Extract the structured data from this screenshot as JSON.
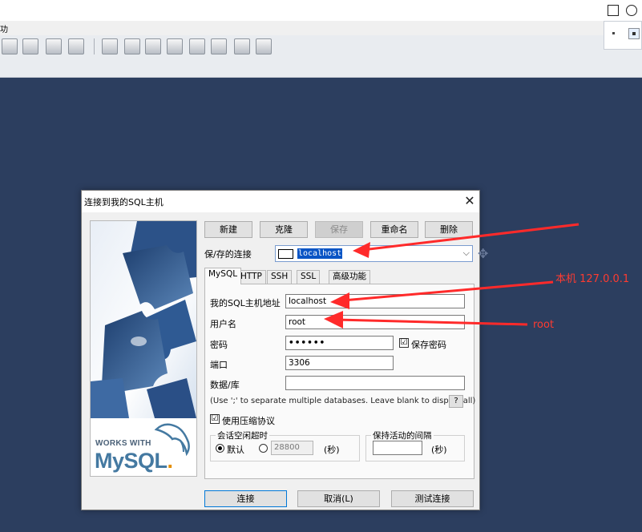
{
  "app": {
    "menu_fragment": "功",
    "toolbar_icons": [
      "new-query-icon",
      "open-icon",
      "save-icon",
      "export-icon",
      "backup-icon",
      "database-icon",
      "schema-icon",
      "scheduler-icon",
      "user-manager-icon",
      "history-icon",
      "grid-icon",
      "table-icon",
      "relations-icon"
    ]
  },
  "dialog": {
    "title": "连接到我的SQL主机",
    "buttons": {
      "new": "新建",
      "clone": "克隆",
      "save": "保存",
      "rename": "重命名",
      "delete": "删除"
    },
    "saved_connection": {
      "label": "保/存的连接",
      "value": "localhost"
    },
    "tabs": [
      "MySQL",
      "HTTP",
      "SSH",
      "SSL",
      "高级功能"
    ],
    "form": {
      "host_label": "我的SQL主机地址",
      "host_value": "localhost",
      "user_label": "用户名",
      "user_value": "root",
      "password_label": "密码",
      "password_value": "••••••",
      "save_password_label": "保存密码",
      "save_password_checked": "☑",
      "port_label": "端口",
      "port_value": "3306",
      "database_label": "数据/库",
      "database_value": "",
      "database_hint": "(Use ';' to separate multiple databases. Leave blank to display all)",
      "help_label": "?",
      "compress_label": "使用压缩协议",
      "compress_checked": "☑",
      "timeout_group": "会话空闲超时",
      "timeout_default_label": "默认",
      "timeout_value": "28800",
      "seconds_label": "(秒)",
      "keepalive_group": "保持活动的间隔",
      "keepalive_value": ""
    },
    "footer": {
      "connect": "连接",
      "cancel": "取消(L)",
      "test": "测试连接"
    },
    "brand": {
      "works_with": "WORKS WITH",
      "mysql_word": "MySQL",
      "mysql_mark": "."
    }
  },
  "annotations": {
    "localhost_note": "本机 127.0.0.1",
    "root_note": "root",
    "arrow_color": "#ff2a2a"
  }
}
